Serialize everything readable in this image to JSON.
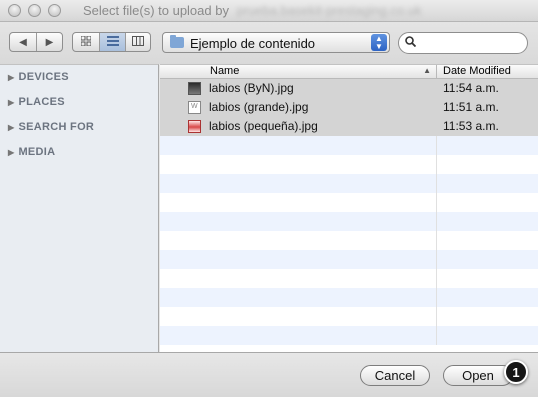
{
  "window": {
    "title": "Select file(s) to upload by",
    "title_domain": "prueba.basekit-prestaging.co.uk"
  },
  "toolbar": {
    "back_icon": "back-arrow-icon",
    "forward_icon": "forward-arrow-icon",
    "view_icons": [
      "icon-view-icon",
      "list-view-icon",
      "column-view-icon"
    ],
    "active_view": "list",
    "location": "Ejemplo de contenido",
    "search_placeholder": ""
  },
  "sidebar": {
    "items": [
      {
        "label": "DEVICES"
      },
      {
        "label": "PLACES"
      },
      {
        "label": "SEARCH FOR"
      },
      {
        "label": "MEDIA"
      }
    ]
  },
  "list": {
    "columns": {
      "name": "Name",
      "date": "Date Modified"
    },
    "files": [
      {
        "name": "labios (ByN).jpg",
        "date": "11:54 a.m.",
        "icon": "bw-image-icon",
        "selected": true
      },
      {
        "name": "labios (grande).jpg",
        "date": "11:51 a.m.",
        "icon": "document-icon",
        "selected": true
      },
      {
        "name": "labios (pequeña).jpg",
        "date": "11:53 a.m.",
        "icon": "red-image-icon",
        "selected": true
      }
    ]
  },
  "buttons": {
    "cancel": "Cancel",
    "open": "Open"
  },
  "annotation": {
    "badge": "1"
  },
  "colors": {
    "selection": "#d4d4d4",
    "stripe": "#edf3fe",
    "sidebar": "#e9edf2",
    "accent": "#2c63c4"
  }
}
